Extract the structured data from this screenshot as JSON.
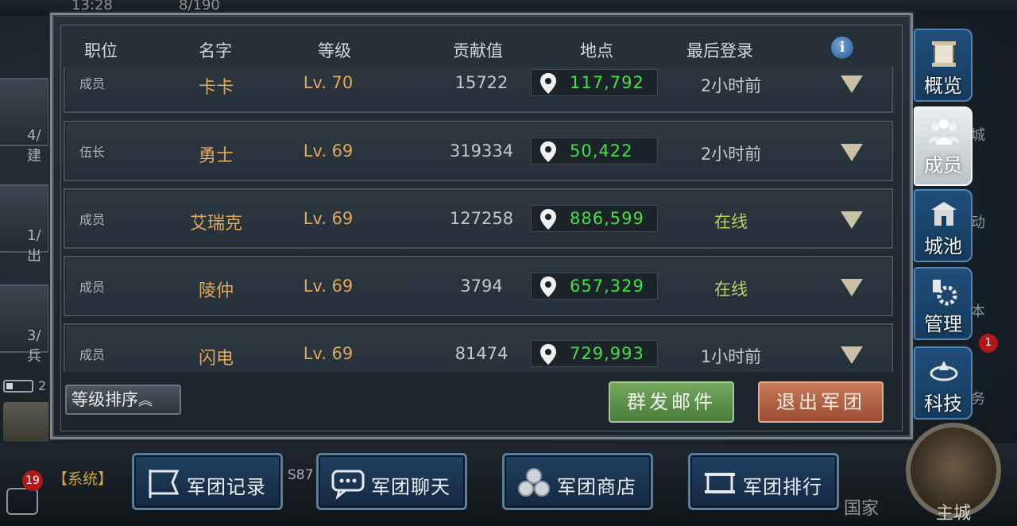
{
  "status_bar": {
    "time": "13:28",
    "resource": "8/190"
  },
  "background": {
    "left_tiles": [
      {
        "line1": "4/",
        "line2": "建"
      },
      {
        "line1": "1/",
        "line2": "出"
      },
      {
        "line1": "3/",
        "line2": "兵"
      }
    ],
    "battery_level": "2",
    "system_badge": "19",
    "system_text": "【系统】",
    "system_suffix": "S87",
    "bottom_country": "国家",
    "main_city": "主城",
    "right_fragments": [
      "城",
      "动",
      "本",
      "务"
    ],
    "tech_badge": "1"
  },
  "table": {
    "headers": {
      "rank": "职位",
      "name": "名字",
      "level": "等级",
      "contribution": "贡献值",
      "location": "地点",
      "last_login": "最后登录"
    },
    "info_icon_text": "i",
    "rows": [
      {
        "rank": "成员",
        "name": "卡卡",
        "level": "Lv. 70",
        "contribution": "15722",
        "location": "117,792",
        "last_login": "2小时前",
        "online": false
      },
      {
        "rank": "伍长",
        "name": "勇士",
        "level": "Lv. 69",
        "contribution": "319334",
        "location": "50,422",
        "last_login": "2小时前",
        "online": false
      },
      {
        "rank": "成员",
        "name": "艾瑞克",
        "level": "Lv. 69",
        "contribution": "127258",
        "location": "886,599",
        "last_login": "在线",
        "online": true
      },
      {
        "rank": "成员",
        "name": "陵仲",
        "level": "Lv. 69",
        "contribution": "3794",
        "location": "657,329",
        "last_login": "在线",
        "online": true
      },
      {
        "rank": "成员",
        "name": "闪电",
        "level": "Lv. 69",
        "contribution": "81474",
        "location": "729,993",
        "last_login": "1小时前",
        "online": false
      }
    ]
  },
  "actions": {
    "sort_label": "等级排序",
    "mass_mail": "群发邮件",
    "leave_legion": "退出军团"
  },
  "side_tabs": [
    {
      "label": "概览",
      "icon": "scroll-icon",
      "active": false
    },
    {
      "label": "成员",
      "icon": "members-icon",
      "active": true
    },
    {
      "label": "城池",
      "icon": "castle-icon",
      "active": false
    },
    {
      "label": "管理",
      "icon": "gear-icon",
      "active": false
    },
    {
      "label": "科技",
      "icon": "tech-icon",
      "active": false
    }
  ],
  "bottom_buttons": [
    {
      "label": "军团记录",
      "icon": "flag-icon"
    },
    {
      "label": "军团聊天",
      "icon": "chat-icon"
    },
    {
      "label": "军团商店",
      "icon": "coins-icon"
    },
    {
      "label": "军团排行",
      "icon": "banner-icon"
    }
  ],
  "colors": {
    "location_green": "#44e04a",
    "name_gold": "#e0a85a",
    "online_green": "#b6d25a",
    "tab_blue": "#1f4e7a",
    "mail_green": "#5a8f49",
    "exit_red": "#b4613f"
  }
}
